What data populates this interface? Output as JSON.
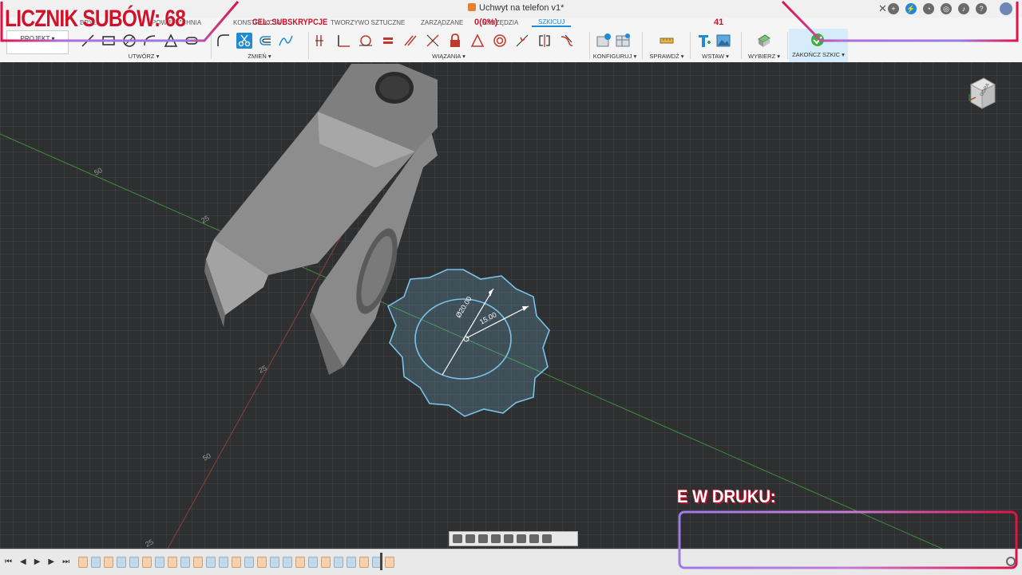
{
  "window": {
    "title": "Uchwyt na telefon v1*"
  },
  "ribbon": {
    "workspace": "PROJEKT",
    "tabs": [
      "BRYŁA",
      "POWIERZCHNIA",
      "KONSTRUKCJA",
      "TWORZYWO SZTUCZNE",
      "ZARZĄDZANE",
      "NARZĘDZIA",
      "SZKICUJ"
    ],
    "active_tab": "SZKICUJ",
    "groups": {
      "create": "UTWÓRZ ▾",
      "modify": "ZMIEŃ ▾",
      "constraints": "WIĄZANIA ▾",
      "configure": "KONFIGURUJ ▾",
      "inspect": "SPRAWDŹ ▾",
      "insert": "WSTAW ▾",
      "select": "WYBIERZ ▾",
      "finish": "ZAKOŃCZ SZKIC ▾"
    }
  },
  "viewport": {
    "axis_labels": [
      "50",
      "25",
      "25",
      "50",
      "25"
    ],
    "dimensions": {
      "diameter": "Ø20.00",
      "radius": "15.00"
    },
    "viewcube_face": "GÓRA"
  },
  "overlay": {
    "subs_counter": "LICZNIK SUBÓW: 68",
    "goal_label": "CEL: SUBSKRYPCJE",
    "goal_progress": "0(0%)",
    "goal_number": "41",
    "print_label": "E W DRUKU:"
  },
  "colors": {
    "accent": "#1f8ad6",
    "overlay_red": "#d0122b",
    "sketch_blue": "#79c3e8",
    "viewport_bg": "#2e2f30"
  }
}
